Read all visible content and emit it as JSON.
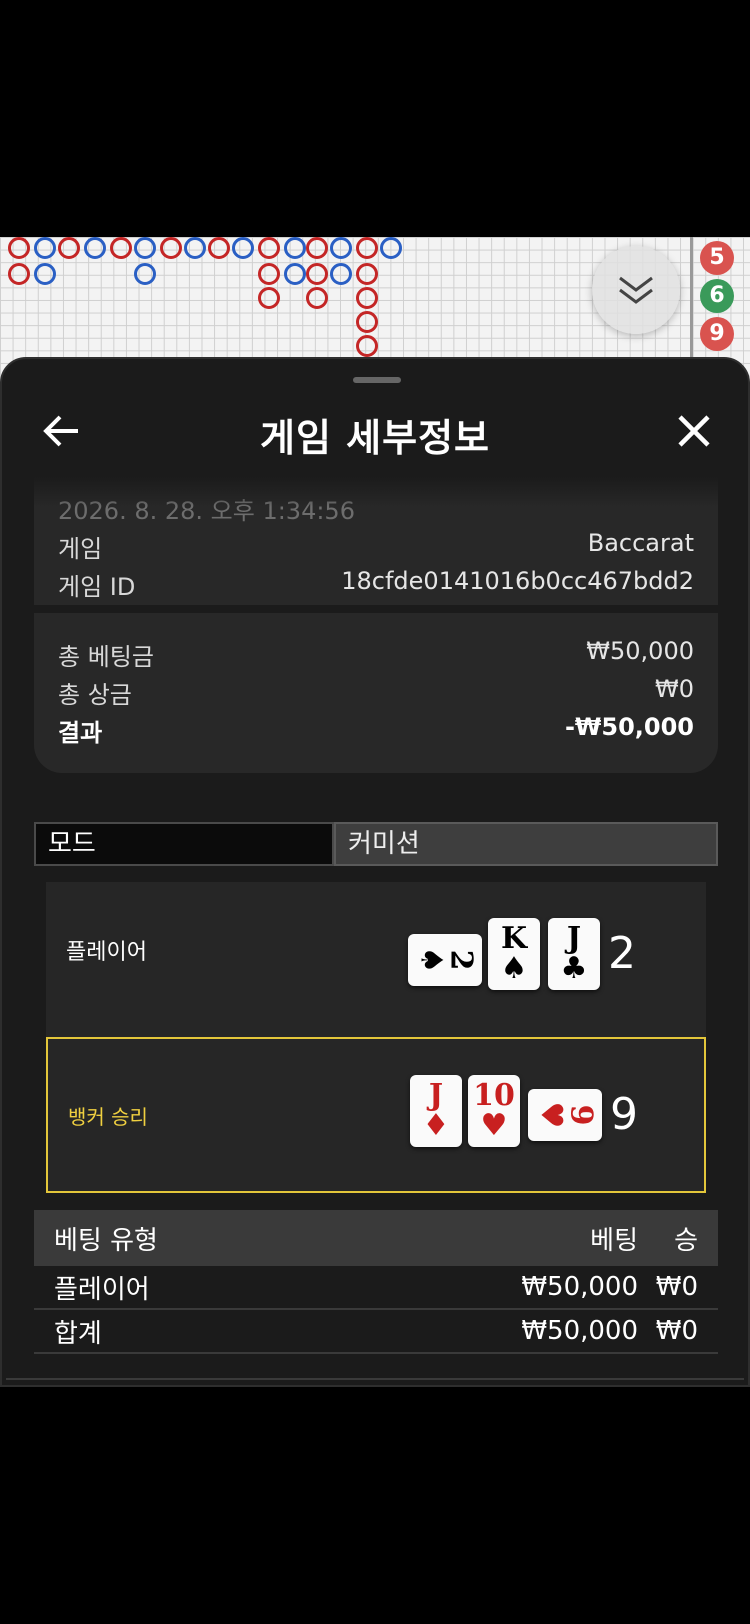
{
  "header": {
    "title": "게임 세부정보"
  },
  "info": {
    "date": "2026. 8. 28. 오후 1:34:56",
    "game_label": "게임",
    "game_value": "Baccarat",
    "game_id_label": "게임 ID",
    "game_id_value": "18cfde0141016b0cc467bdd2"
  },
  "totals": {
    "total_bet_label": "총 베팅금",
    "total_bet_value": "₩50,000",
    "total_win_label": "총 상금",
    "total_win_value": "₩0",
    "result_label": "결과",
    "result_value": "-₩50,000"
  },
  "tabs": {
    "mode": "모드",
    "commission": "커미션"
  },
  "player": {
    "label": "플레이어",
    "score": "2",
    "cards": [
      {
        "rank": "2",
        "suit": "♠",
        "color": "black",
        "orient": "h"
      },
      {
        "rank": "K",
        "suit": "♠",
        "color": "black",
        "orient": "v"
      },
      {
        "rank": "J",
        "suit": "♣",
        "color": "black",
        "orient": "v"
      }
    ]
  },
  "banker": {
    "label": "뱅커 승리",
    "score": "9",
    "cards": [
      {
        "rank": "J",
        "suit": "♦",
        "color": "red",
        "orient": "v"
      },
      {
        "rank": "10",
        "suit": "♥",
        "color": "red",
        "orient": "v"
      },
      {
        "rank": "9",
        "suit": "♥",
        "color": "red",
        "orient": "h"
      }
    ]
  },
  "bet_table": {
    "headers": [
      "베팅 유형",
      "베팅",
      "승"
    ],
    "rows": [
      [
        "플레이어",
        "₩50,000",
        "₩0"
      ],
      [
        "합계",
        "₩50,000",
        "₩0"
      ]
    ]
  },
  "roadmap": {
    "side_numbers": [
      "5",
      "6",
      "9"
    ],
    "side_colors": [
      "#d9534f",
      "#3a9a5a",
      "#d9534f"
    ]
  },
  "colors": {
    "accent": "#e3c63a",
    "sheet_bg": "#1b1b1b",
    "red_bead": "#c42626",
    "blue_bead": "#2a5fc4"
  }
}
